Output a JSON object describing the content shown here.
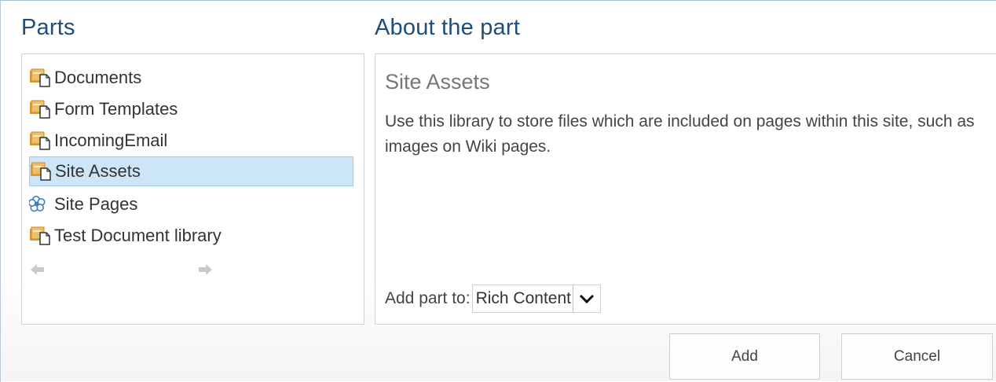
{
  "parts": {
    "heading": "Parts",
    "items": [
      {
        "label": "Documents",
        "icon": "document-library-icon",
        "selected": false
      },
      {
        "label": "Form Templates",
        "icon": "document-library-icon",
        "selected": false
      },
      {
        "label": "IncomingEmail",
        "icon": "document-library-icon",
        "selected": false
      },
      {
        "label": "Site Assets",
        "icon": "document-library-icon",
        "selected": true
      },
      {
        "label": "Site Pages",
        "icon": "wiki-pages-icon",
        "selected": false
      },
      {
        "label": "Test Document library",
        "icon": "document-library-icon",
        "selected": false
      }
    ],
    "nav": {
      "prev_icon": "arrow-left-icon",
      "next_icon": "arrow-right-icon"
    }
  },
  "about": {
    "heading": "About the part",
    "title": "Site Assets",
    "description": "Use this library to store files which are included on pages within this site, such as images on Wiki pages.",
    "add_to_label": "Add part to:",
    "add_to_value": "Rich Content"
  },
  "buttons": {
    "add": "Add",
    "cancel": "Cancel"
  },
  "colors": {
    "heading": "#1f4e78",
    "selection": "#cde6f7",
    "selection_border": "#9fcdee",
    "folder": "#e2a84a"
  }
}
